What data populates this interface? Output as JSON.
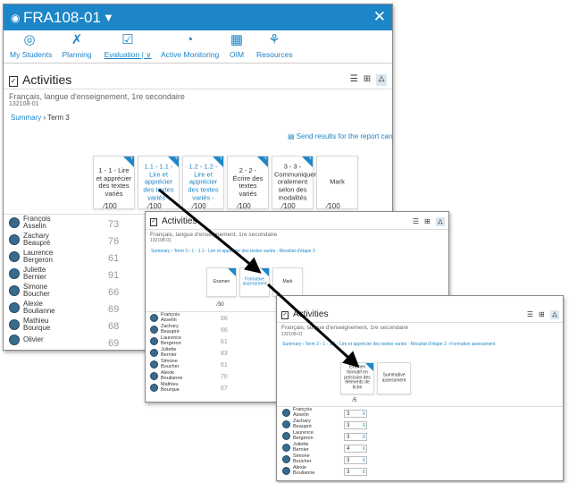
{
  "window": {
    "title": "FRA108-01"
  },
  "nav": [
    "My Students",
    "Planning",
    "Evaluation",
    "Active Monitoring",
    "OIM",
    "Resources"
  ],
  "page": {
    "heading": "Activities",
    "course": "Français, langue d'enseignement, 1re secondaire",
    "code": "132108-01"
  },
  "crumb1": {
    "summary": "Summary",
    "sep": "›",
    "term": "Term 3"
  },
  "send_results": "Send results for the report card",
  "w1_cards": [
    "1 - 1 - Lire et apprécier des textes variés",
    "1.1 - 1.1 - Lire et apprécier des textes variés -",
    "1.2 - 1.2 - Lire et apprécier des textes variés -",
    "2 - 2 - Écrire des textes variés",
    "3 - 3 - Communiquer oralement selon des modalités",
    "Mark"
  ],
  "scores": [
    "100",
    "100",
    "100",
    "100",
    "100",
    "100"
  ],
  "students": [
    {
      "first": "François",
      "last": "Asselin",
      "val": "73"
    },
    {
      "first": "Zachary",
      "last": "Beaupré",
      "val": "76"
    },
    {
      "first": "Laurence",
      "last": "Bergeron",
      "val": "61"
    },
    {
      "first": "Juliette",
      "last": "Bernier",
      "val": "91"
    },
    {
      "first": "Simone",
      "last": "Boucher",
      "val": "66"
    },
    {
      "first": "Alexie",
      "last": "Boulianne",
      "val": "69"
    },
    {
      "first": "Mathieu",
      "last": "Bourque",
      "val": "68"
    },
    {
      "first": "Olivier",
      "last": "",
      "val": "69"
    }
  ],
  "w2_crumb": "Summary › Term 3 › 1 - 1.1 - Lire et apprécier des textes variés - Résultat d'étape 3",
  "w2_cards": [
    "Examen",
    "Formative assessment",
    "Mark"
  ],
  "w2_score": "30",
  "w2_vals": [
    "66",
    "66",
    "61",
    "83",
    "61",
    "70",
    "67"
  ],
  "w3_crumb": "Summary › Term 3 › 1 - 1.1 - Lire et apprécier des textes variés - Résultat d'étape 3 › Formative assessment",
  "w3_cards": [
    "Examen formatif en précision des éléments de fiche",
    "Summative assessment"
  ],
  "w3_score": "5",
  "w3_vals": [
    "3",
    "3",
    "3",
    "4",
    "3",
    "3"
  ],
  "colors": {
    "accent": "#1c86c8"
  }
}
